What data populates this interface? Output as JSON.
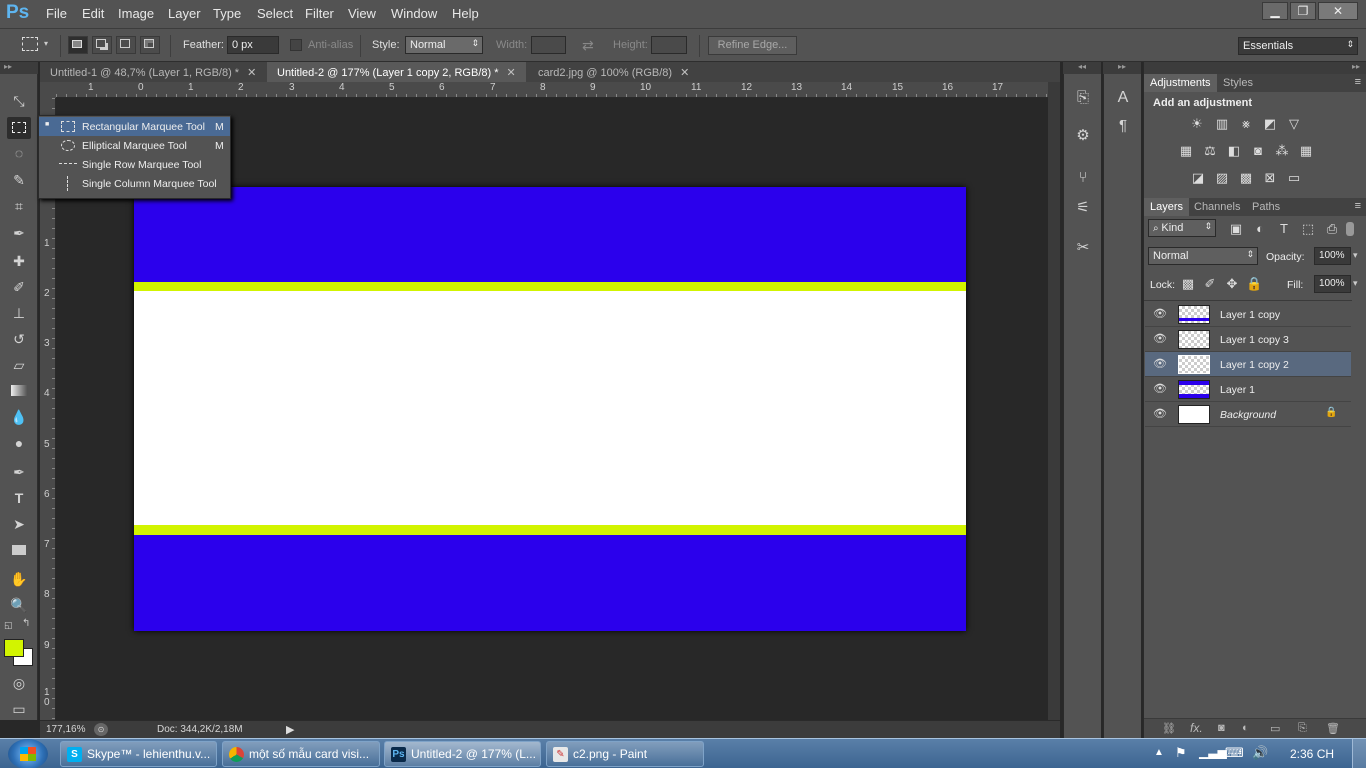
{
  "app": {
    "logo": "Ps"
  },
  "menu": [
    "File",
    "Edit",
    "Image",
    "Layer",
    "Type",
    "Select",
    "Filter",
    "View",
    "Window",
    "Help"
  ],
  "window_controls": {
    "minimize": "▁",
    "restore": "❐",
    "close": "✕"
  },
  "options": {
    "feather_label": "Feather:",
    "feather_value": "0 px",
    "antialias_label": "Anti-alias",
    "style_label": "Style:",
    "style_value": "Normal",
    "width_label": "Width:",
    "height_label": "Height:",
    "refine_edge": "Refine Edge...",
    "workspace": "Essentials"
  },
  "tabs": [
    {
      "label": "Untitled-1 @ 48,7% (Layer 1, RGB/8) *",
      "close": "✕"
    },
    {
      "label": "Untitled-2 @ 177% (Layer 1 copy 2, RGB/8) *",
      "close": "✕"
    },
    {
      "label": "card2.jpg @ 100% (RGB/8)",
      "close": "✕"
    }
  ],
  "ruler": {
    "h_ticks": [
      "1",
      "0",
      "1",
      "2",
      "3",
      "4",
      "5",
      "6",
      "7",
      "8",
      "9",
      "10",
      "11",
      "12",
      "13",
      "14",
      "15",
      "16",
      "17"
    ],
    "v_ticks": [
      "1",
      "2",
      "3",
      "4",
      "5",
      "6",
      "7",
      "8",
      "9",
      "1 0"
    ]
  },
  "flyout": {
    "items": [
      {
        "label": "Rectangular Marquee Tool",
        "shortcut": "M"
      },
      {
        "label": "Elliptical Marquee Tool",
        "shortcut": "M"
      },
      {
        "label": "Single Row Marquee Tool",
        "shortcut": ""
      },
      {
        "label": "Single Column Marquee Tool",
        "shortcut": ""
      }
    ]
  },
  "status": {
    "zoom": "177,16%",
    "doc": "Doc: 344,2K/2,18M"
  },
  "adjustments": {
    "tab_adjustments": "Adjustments",
    "tab_styles": "Styles",
    "heading": "Add an adjustment"
  },
  "layers_panel": {
    "tab_layers": "Layers",
    "tab_channels": "Channels",
    "tab_paths": "Paths",
    "kind": "Kind",
    "blend_mode": "Normal",
    "opacity_label": "Opacity:",
    "opacity_value": "100%",
    "lock_label": "Lock:",
    "fill_label": "Fill:",
    "fill_value": "100%",
    "layers": [
      {
        "name": "Layer 1 copy"
      },
      {
        "name": "Layer 1 copy 3"
      },
      {
        "name": "Layer 1 copy 2"
      },
      {
        "name": "Layer 1"
      },
      {
        "name": "Background"
      }
    ]
  },
  "colors": {
    "blue": "#2b00ec",
    "lime": "#d2f400",
    "foreground": "#d2f400",
    "background": "#ffffff",
    "selection": "#59697f"
  },
  "taskbar": {
    "tasks": [
      {
        "label": "Skype™ - lehienthu.v..."
      },
      {
        "label": "một số mẫu card visi..."
      },
      {
        "label": "Untitled-2 @ 177% (L..."
      },
      {
        "label": "c2.png - Paint"
      }
    ],
    "clock": "2:36 CH"
  }
}
